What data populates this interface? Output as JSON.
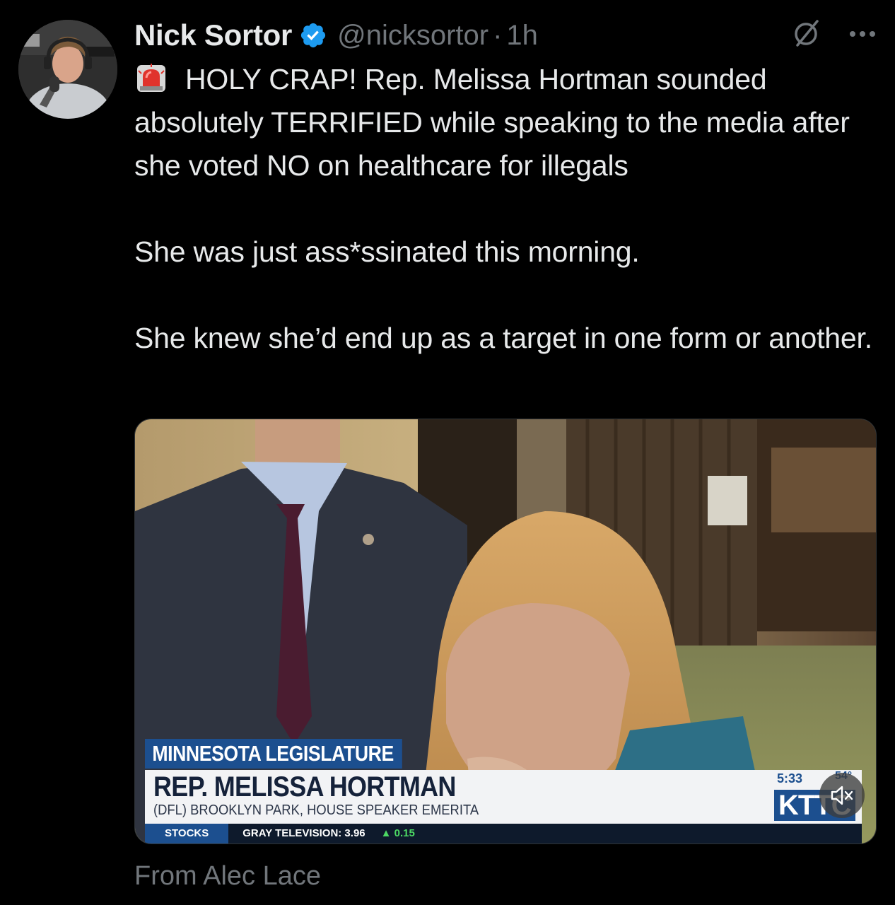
{
  "tweet": {
    "author": {
      "display_name": "Nick Sortor",
      "handle": "@nicksortor",
      "verified": true,
      "avatar_icon": "avatar-photo"
    },
    "separator": "·",
    "time": "1h",
    "text": {
      "line1": "HOLY CRAP! Rep. Melissa Hortman sounded absolutely TERRIFIED while speaking to the media after she voted NO on healthcare for illegals",
      "line2": "She was just ass*ssinated this morning.",
      "line3": "She knew she’d end up as a target in one form or another."
    },
    "attribution": "From Alec Lace"
  },
  "video": {
    "lower_third": {
      "topic": "MINNESOTA LEGISLATURE",
      "name": "REP. MELISSA HORTMAN",
      "subtitle": "(DFL) BROOKLYN PARK, HOUSE SPEAKER EMERITA",
      "time": "5:33",
      "temp": "54°",
      "station": "KTTC"
    },
    "ticker": {
      "label": "STOCKS",
      "item": "GRAY TELEVISION: 3.96",
      "change": "▲ 0.15"
    },
    "muted": true
  },
  "colors": {
    "background": "#000000",
    "text_primary": "#e7e9ea",
    "text_secondary": "#71767b",
    "verified_blue": "#1d9bf0",
    "news_blue": "#1c4f8f"
  }
}
